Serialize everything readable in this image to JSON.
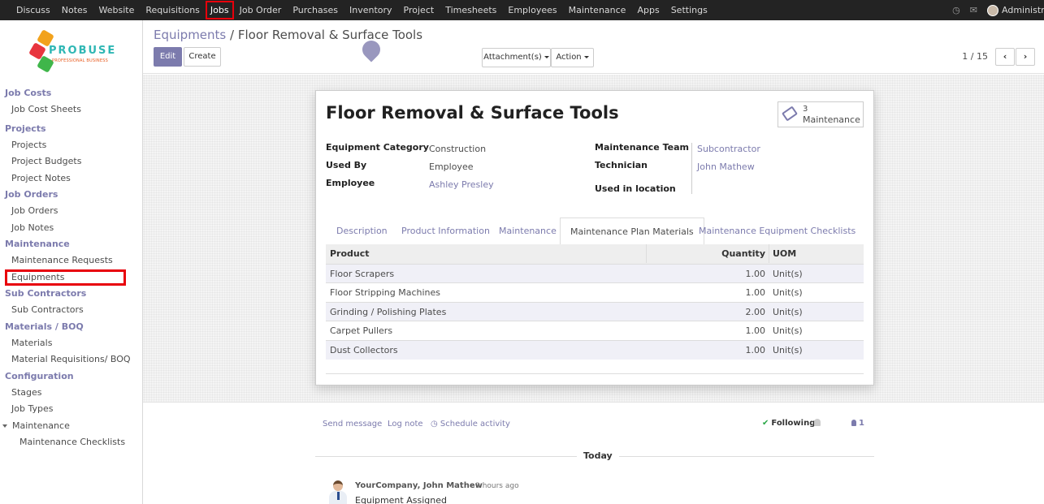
{
  "topbar": {
    "menu": [
      "Discuss",
      "Notes",
      "Website",
      "Requisitions",
      "Jobs",
      "Job Order",
      "Purchases",
      "Inventory",
      "Project",
      "Timesheets",
      "Employees",
      "Maintenance",
      "Apps",
      "Settings"
    ],
    "active": "Jobs",
    "user": "Administrator",
    "icons": [
      "clock-icon",
      "chat-icon"
    ]
  },
  "logo": {
    "brand": "PROBUSE",
    "tagline": "PROFESSIONAL BUSINESS"
  },
  "sidebar": {
    "sections": [
      {
        "title": "Job Costs",
        "items": [
          "Job Cost Sheets"
        ]
      },
      {
        "title": "Projects",
        "items": [
          "Projects",
          "Project Budgets",
          "Project Notes"
        ]
      },
      {
        "title": "Job Orders",
        "items": [
          "Job Orders",
          "Job Notes"
        ]
      },
      {
        "title": "Maintenance",
        "items": [
          "Maintenance Requests",
          "Equipments"
        ]
      },
      {
        "title": "Sub Contractors",
        "items": [
          "Sub Contractors"
        ]
      },
      {
        "title": "Materials / BOQ",
        "items": [
          "Materials",
          "Material Requisitions/ BOQ"
        ]
      },
      {
        "title": "Configuration",
        "items": [
          "Stages",
          "Job Types",
          "Maintenance",
          "Maintenance Checklists"
        ]
      }
    ],
    "highlighted": "Equipments"
  },
  "controls": {
    "breadcrumb_parent": "Equipments",
    "breadcrumb_sep": " / ",
    "breadcrumb_current": "Floor Removal & Surface Tools",
    "edit_label": "Edit",
    "create_label": "Create",
    "attachment_label": "Attachment(s)",
    "action_label": "Action",
    "pager": "1 / 15"
  },
  "record": {
    "title": "Floor Removal & Surface Tools",
    "stat_count": "3",
    "stat_label": "Maintenance",
    "fields_left": [
      {
        "label": "Equipment Category",
        "value": "Construction",
        "link": false
      },
      {
        "label": "Used By",
        "value": "Employee",
        "link": false
      },
      {
        "label": "Employee",
        "value": "Ashley Presley",
        "link": true
      }
    ],
    "fields_right": [
      {
        "label": "Maintenance Team",
        "value": "Subcontractor"
      },
      {
        "label": "Technician",
        "value": "John Mathew"
      },
      {
        "label": "Used in location",
        "value": ""
      }
    ],
    "tabs": [
      "Description",
      "Product Information",
      "Maintenance",
      "Maintenance Plan Materials",
      "Maintenance Equipment Checklists"
    ],
    "active_tab": "Maintenance Plan Materials",
    "table": {
      "headers": [
        "Product",
        "Quantity",
        "UOM"
      ],
      "rows": [
        [
          "Floor Scrapers",
          "1.00",
          "Unit(s)"
        ],
        [
          "Floor Stripping Machines",
          "1.00",
          "Unit(s)"
        ],
        [
          "Grinding / Polishing Plates",
          "2.00",
          "Unit(s)"
        ],
        [
          "Carpet Pullers",
          "1.00",
          "Unit(s)"
        ],
        [
          "Dust Collectors",
          "1.00",
          "Unit(s)"
        ]
      ]
    }
  },
  "chatter": {
    "send_message": "Send message",
    "log_note": "Log note",
    "schedule_activity": "Schedule activity",
    "following": "Following",
    "followers": "1",
    "today": "Today",
    "author": "YourCompany, John Mathew",
    "ago": "- 3 hours ago",
    "body": "Equipment Assigned"
  }
}
